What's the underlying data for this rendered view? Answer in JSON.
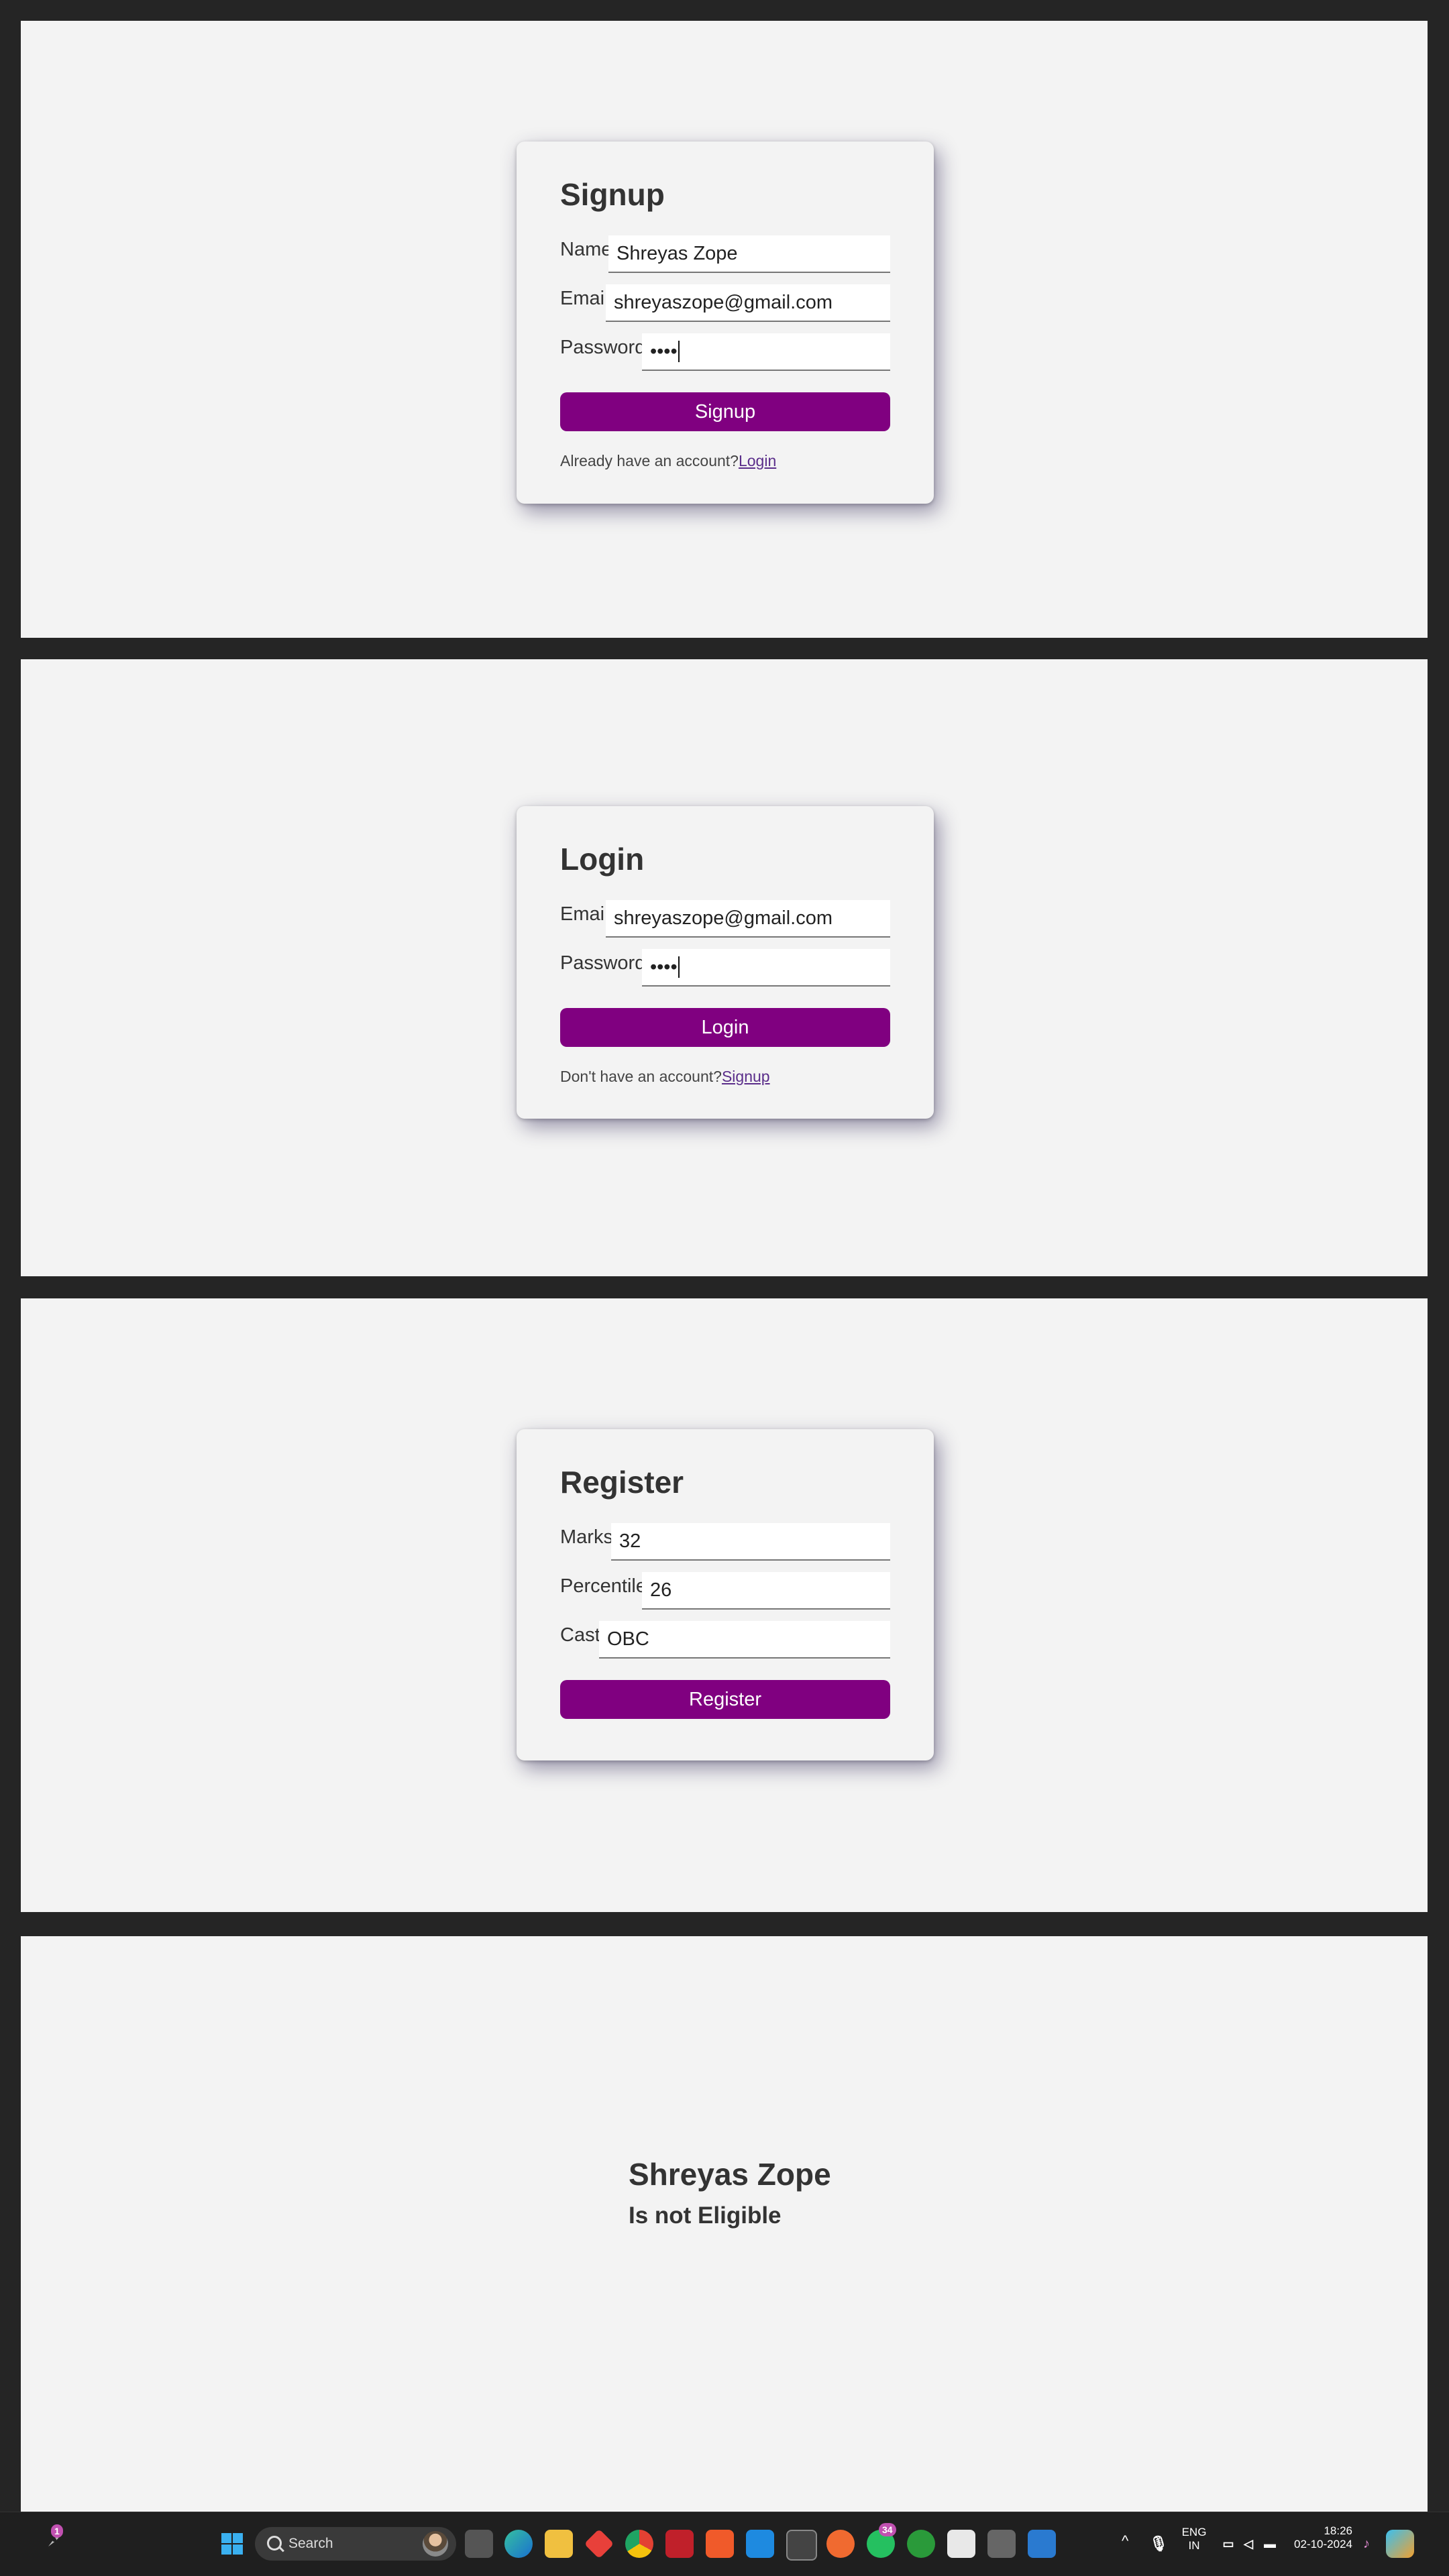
{
  "signup": {
    "title": "Signup",
    "name_label": "Name",
    "name_value": "Shreyas Zope",
    "email_label": "Email",
    "email_value": "shreyaszope@gmail.com",
    "password_label": "Password",
    "password_value": "••••",
    "button_label": "Signup",
    "hint_text": "Already have an account?",
    "hint_link": "Login"
  },
  "login": {
    "title": "Login",
    "email_label": "Email",
    "email_value": "shreyaszope@gmail.com",
    "password_label": "Password",
    "password_value": "••••",
    "button_label": "Login",
    "hint_text": "Don't have an account?",
    "hint_link": "Signup"
  },
  "register": {
    "title": "Register",
    "marks_label": "Marks",
    "marks_value": "32",
    "percentile_label": "Percentile",
    "percentile_value": "26",
    "cast_label": "Cast",
    "cast_value": "OBC",
    "button_label": "Register"
  },
  "result": {
    "name": "Shreyas Zope",
    "status": "Is not Eligible"
  },
  "taskbar": {
    "search_label": "Search",
    "notification_count": "1",
    "whatsapp_badge": "34",
    "lang_line1": "ENG",
    "lang_line2": "IN",
    "time": "18:26",
    "date": "02-10-2024",
    "accent_color": "#800080",
    "icons": [
      "start-icon",
      "task-view-icon",
      "edge-icon",
      "file-explorer-icon",
      "git-icon",
      "chrome-icon",
      "mcafee-icon",
      "brave-icon",
      "vscode-icon",
      "terminal-icon",
      "postman-icon",
      "whatsapp-icon",
      "xbox-icon",
      "store-icon",
      "app-icon",
      "snipping-tool-icon"
    ]
  }
}
